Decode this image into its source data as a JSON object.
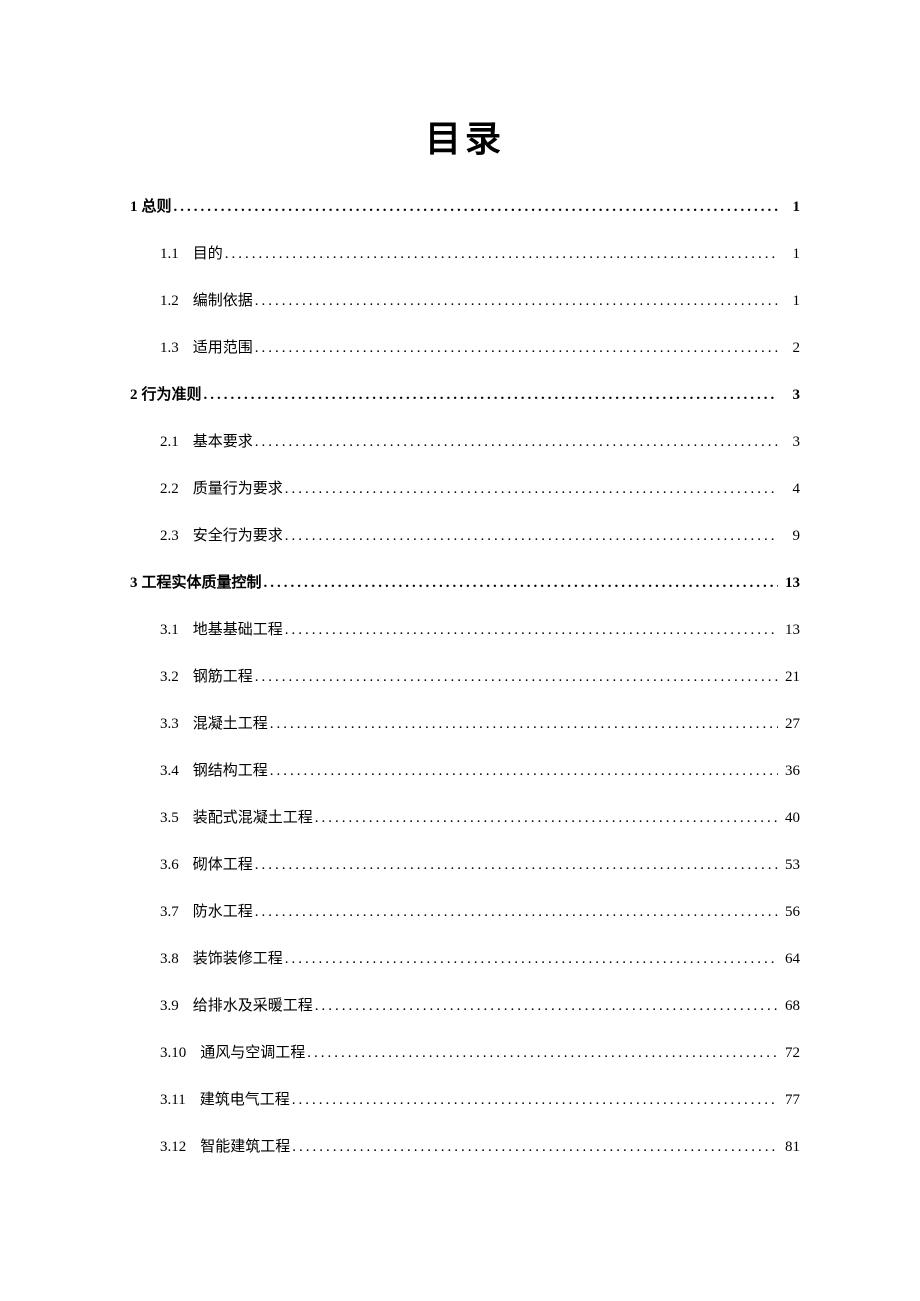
{
  "title": "目录",
  "toc": [
    {
      "level": 1,
      "num": "1",
      "text": "总则",
      "page": "1"
    },
    {
      "level": 2,
      "num": "1.1",
      "text": "目的",
      "page": "1"
    },
    {
      "level": 2,
      "num": "1.2",
      "text": "编制依据",
      "page": "1"
    },
    {
      "level": 2,
      "num": "1.3",
      "text": "适用范围",
      "page": "2"
    },
    {
      "level": 1,
      "num": "2",
      "text": "行为准则",
      "page": "3"
    },
    {
      "level": 2,
      "num": "2.1",
      "text": "基本要求",
      "page": "3"
    },
    {
      "level": 2,
      "num": "2.2",
      "text": "质量行为要求",
      "page": "4"
    },
    {
      "level": 2,
      "num": "2.3",
      "text": "安全行为要求",
      "page": "9"
    },
    {
      "level": 1,
      "num": "3",
      "text": "工程实体质量控制",
      "page": "13"
    },
    {
      "level": 2,
      "num": "3.1",
      "text": "地基基础工程",
      "page": "13"
    },
    {
      "level": 2,
      "num": "3.2",
      "text": "钢筋工程",
      "page": "21"
    },
    {
      "level": 2,
      "num": "3.3",
      "text": "混凝土工程",
      "page": "27"
    },
    {
      "level": 2,
      "num": "3.4",
      "text": "钢结构工程",
      "page": "36"
    },
    {
      "level": 2,
      "num": "3.5",
      "text": "装配式混凝土工程",
      "page": "40"
    },
    {
      "level": 2,
      "num": "3.6",
      "text": "砌体工程",
      "page": "53"
    },
    {
      "level": 2,
      "num": "3.7",
      "text": "防水工程",
      "page": "56"
    },
    {
      "level": 2,
      "num": "3.8",
      "text": "装饰装修工程",
      "page": "64"
    },
    {
      "level": 2,
      "num": "3.9",
      "text": "给排水及采暖工程",
      "page": "68"
    },
    {
      "level": 2,
      "num": "3.10",
      "text": "通风与空调工程",
      "page": "72"
    },
    {
      "level": 2,
      "num": "3.11",
      "text": "建筑电气工程",
      "page": "77"
    },
    {
      "level": 2,
      "num": "3.12",
      "text": "智能建筑工程",
      "page": "81"
    }
  ]
}
